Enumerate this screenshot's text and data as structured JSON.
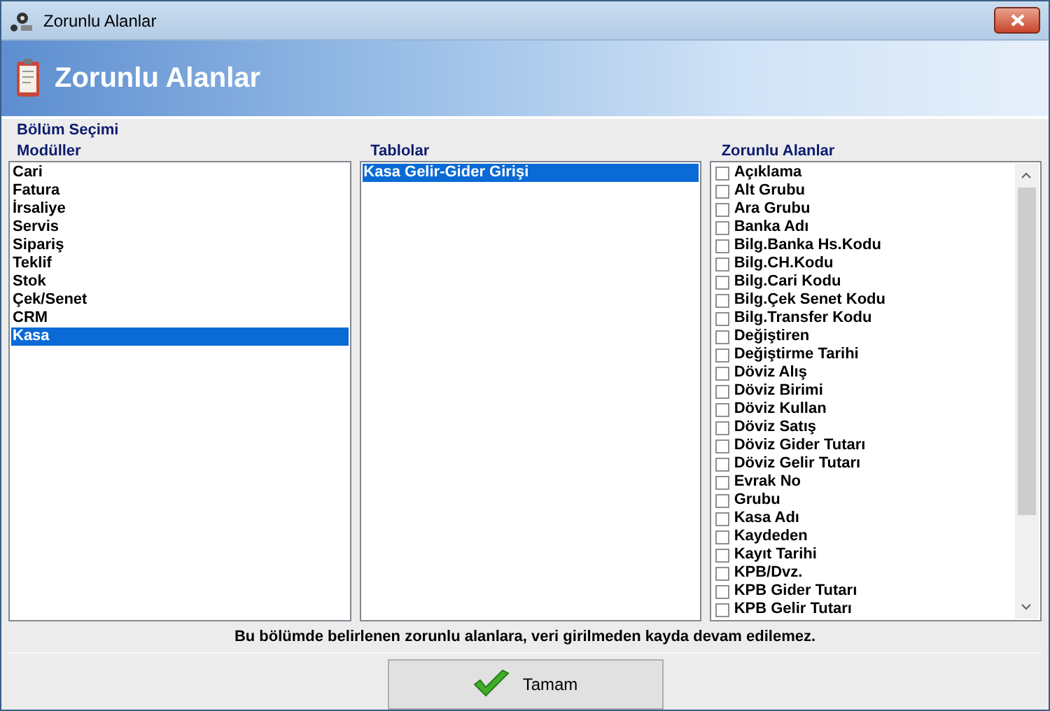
{
  "window": {
    "title": "Zorunlu Alanlar"
  },
  "header": {
    "title": "Zorunlu Alanlar"
  },
  "section_title": "Bölüm Seçimi",
  "modules": {
    "title": "Modüller",
    "items": [
      {
        "label": "Cari",
        "selected": false
      },
      {
        "label": "Fatura",
        "selected": false
      },
      {
        "label": "İrsaliye",
        "selected": false
      },
      {
        "label": "Servis",
        "selected": false
      },
      {
        "label": "Sipariş",
        "selected": false
      },
      {
        "label": "Teklif",
        "selected": false
      },
      {
        "label": "Stok",
        "selected": false
      },
      {
        "label": "Çek/Senet",
        "selected": false
      },
      {
        "label": "CRM",
        "selected": false
      },
      {
        "label": "Kasa",
        "selected": true
      }
    ]
  },
  "tables": {
    "title": "Tablolar",
    "items": [
      {
        "label": "Kasa Gelir-Gider Girişi",
        "selected": true
      }
    ]
  },
  "fields": {
    "title": "Zorunlu Alanlar",
    "items": [
      {
        "label": "Açıklama",
        "checked": false
      },
      {
        "label": "Alt Grubu",
        "checked": false
      },
      {
        "label": "Ara Grubu",
        "checked": false
      },
      {
        "label": "Banka Adı",
        "checked": false
      },
      {
        "label": "Bilg.Banka Hs.Kodu",
        "checked": false
      },
      {
        "label": "Bilg.CH.Kodu",
        "checked": false
      },
      {
        "label": "Bilg.Cari Kodu",
        "checked": false
      },
      {
        "label": "Bilg.Çek Senet Kodu",
        "checked": false
      },
      {
        "label": "Bilg.Transfer Kodu",
        "checked": false
      },
      {
        "label": "Değiştiren",
        "checked": false
      },
      {
        "label": "Değiştirme Tarihi",
        "checked": false
      },
      {
        "label": "Döviz Alış",
        "checked": false
      },
      {
        "label": "Döviz Birimi",
        "checked": false
      },
      {
        "label": "Döviz Kullan",
        "checked": false
      },
      {
        "label": "Döviz Satış",
        "checked": false
      },
      {
        "label": "Döviz Gider Tutarı",
        "checked": false
      },
      {
        "label": "Döviz Gelir Tutarı",
        "checked": false
      },
      {
        "label": "Evrak No",
        "checked": false
      },
      {
        "label": "Grubu",
        "checked": false
      },
      {
        "label": "Kasa Adı",
        "checked": false
      },
      {
        "label": "Kaydeden",
        "checked": false
      },
      {
        "label": "Kayıt Tarihi",
        "checked": false
      },
      {
        "label": "KPB/Dvz.",
        "checked": false
      },
      {
        "label": "KPB Gider Tutarı",
        "checked": false
      },
      {
        "label": "KPB Gelir Tutarı",
        "checked": false
      }
    ]
  },
  "message": "Bu bölümde belirlenen zorunlu alanlara, veri girilmeden kayda devam edilemez.",
  "ok_button": "Tamam"
}
